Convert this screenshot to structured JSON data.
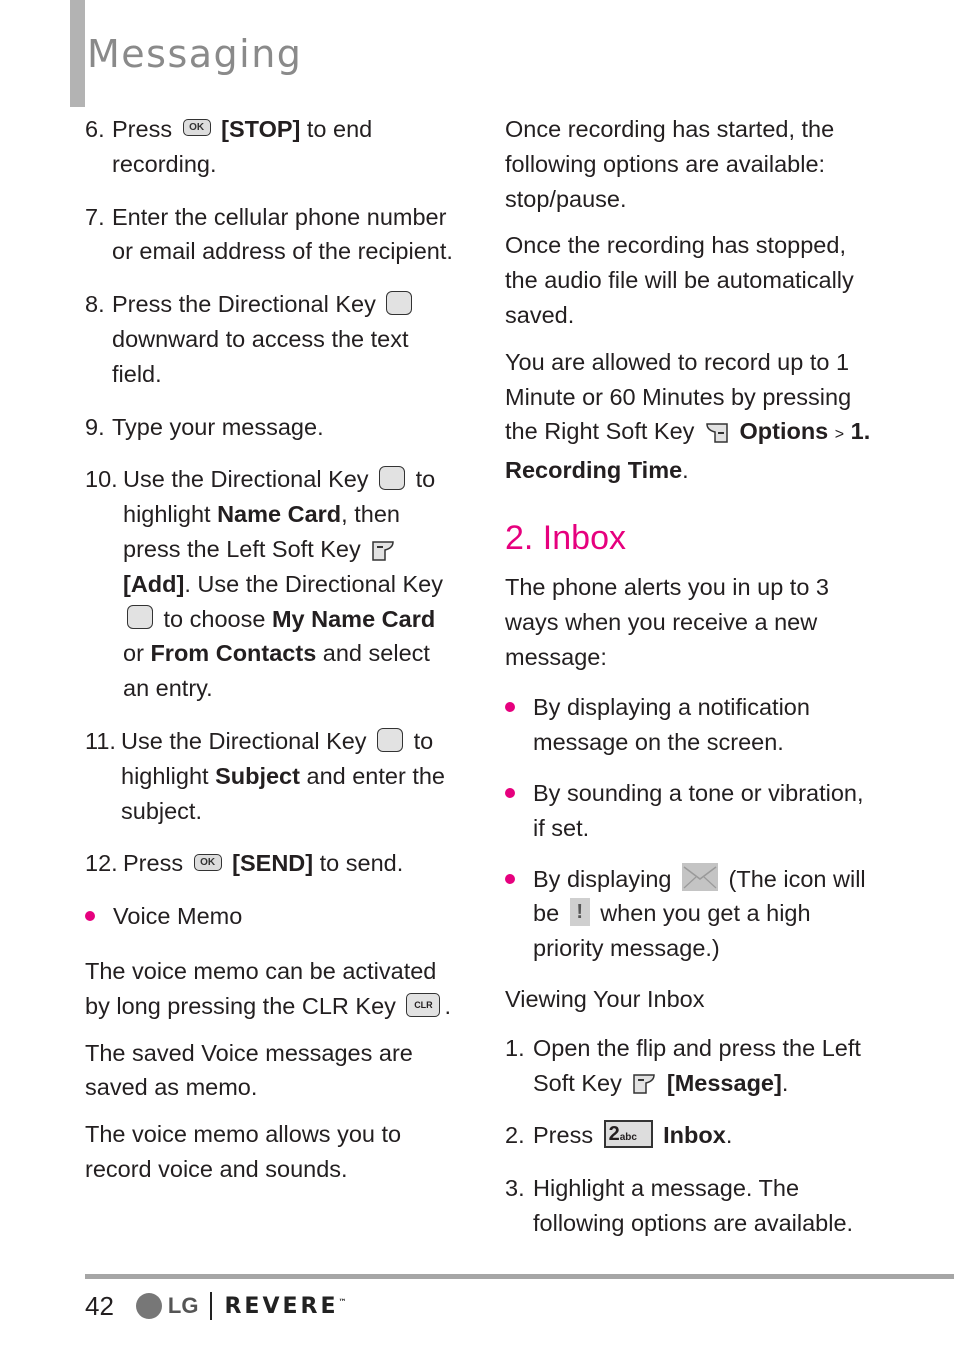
{
  "header": {
    "title": "Messaging"
  },
  "left_column": {
    "steps": [
      {
        "num": "6.",
        "parts": [
          "Press",
          "[STOP]",
          "to end recording."
        ]
      },
      {
        "num": "7.",
        "text": "Enter the cellular phone number or email address of the recipient."
      },
      {
        "num": "8.",
        "parts": [
          "Press the Directional Key",
          "downward to access the text field."
        ]
      },
      {
        "num": "9.",
        "text": "Type your message."
      },
      {
        "num": "10.",
        "parts": [
          "Use the Directional Key",
          "to highlight",
          "Name Card",
          ", then press the Left Soft Key",
          "[Add]",
          ". Use the Directional Key",
          "to choose",
          "My Name Card",
          "or",
          "From Contacts",
          "and select an entry."
        ]
      },
      {
        "num": "11.",
        "parts": [
          "Use the Directional Key",
          "to highlight",
          "Subject",
          "and enter the subject."
        ]
      },
      {
        "num": "12.",
        "parts": [
          "Press",
          "[SEND]",
          "to send."
        ]
      }
    ],
    "voice_memo": {
      "heading": "Voice Memo",
      "p1_parts": [
        "The voice memo can be activated by long pressing the CLR Key",
        "."
      ],
      "p2": "The saved Voice messages are saved as memo.",
      "p3": "The voice memo allows you to record voice and sounds."
    }
  },
  "right_column": {
    "p1": "Once recording has started, the following options are available: stop/pause.",
    "p2": "Once the recording has stopped, the audio file will be automatically saved.",
    "p3_parts": [
      "You are allowed to record up to 1 Minute or 60 Minutes by pressing the Right Soft Key",
      "Options",
      ">",
      "1. Recording Time",
      "."
    ],
    "inbox": {
      "title": "2. Inbox",
      "intro": "The phone alerts you in up to 3 ways when you receive a new message:",
      "bullets": [
        "By displaying a notification message on the screen.",
        "By sounding a tone or vibration, if set."
      ],
      "bullet3_parts": [
        "By displaying",
        "(The icon will be",
        "when you get a high priority message.)"
      ],
      "subhead": "Viewing Your Inbox",
      "steps": [
        {
          "num": "1.",
          "parts": [
            "Open the flip and press the Left Soft Key",
            "[Message]",
            "."
          ]
        },
        {
          "num": "2.",
          "parts": [
            "Press",
            "Inbox",
            "."
          ]
        },
        {
          "num": "3.",
          "text": "Highlight a message. The following options are available."
        }
      ]
    }
  },
  "keys": {
    "ok": "OK",
    "clr": "CLR",
    "two": "2",
    "two_sub": "abc",
    "priority": "!"
  },
  "footer": {
    "page_number": "42",
    "lg": "LG",
    "brand": "REVERE",
    "tm": "™"
  },
  "colors": {
    "accent": "#e6007e",
    "header_bar": "#b3b3b3",
    "title_gray": "#8a8a8a"
  }
}
